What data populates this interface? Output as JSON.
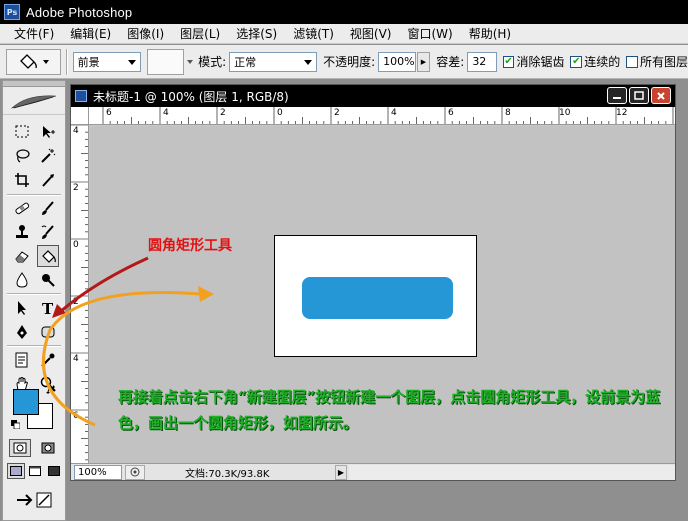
{
  "app": {
    "title": "Adobe Photoshop",
    "icon": "photoshop-icon"
  },
  "menu": [
    "文件(F)",
    "编辑(E)",
    "图像(I)",
    "图层(L)",
    "选择(S)",
    "滤镜(T)",
    "视图(V)",
    "窗口(W)",
    "帮助(H)"
  ],
  "options": {
    "fill_source": "前景",
    "mode_label": "模式:",
    "mode_value": "正常",
    "opacity_label": "不透明度:",
    "opacity_value": "100%",
    "tolerance_label": "容差:",
    "tolerance_value": "32",
    "antialias_label": "消除锯齿",
    "antialias_checked": true,
    "contiguous_label": "连续的",
    "contiguous_checked": true,
    "all_layers_label": "所有图层",
    "all_layers_checked": false
  },
  "document": {
    "title": "未标题-1 @ 100% (图层 1, RGB/8)",
    "zoom": "100%",
    "doc_info": "文档:70.3K/93.8K",
    "hruler_labels": [
      "6",
      "4",
      "2",
      "0",
      "2",
      "4",
      "6",
      "8",
      "10",
      "12"
    ],
    "vruler_labels": [
      "4",
      "2",
      "0",
      "2",
      "4",
      "6"
    ],
    "shape_color": "#2596d6"
  },
  "toolbox": {
    "foreground_color": "#2596d6",
    "background_color": "#ffffff"
  },
  "annotations": {
    "tool_callout": "圆角矩形工具",
    "instruction": "再接着点击右下角“新建图层”按钮新建一个图层，点击圆角矩形工具，设前景为蓝色，画出一个圆角矩形，如图所示。"
  }
}
